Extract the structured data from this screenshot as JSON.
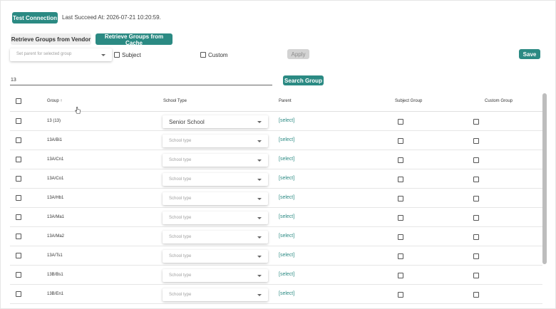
{
  "toolbar": {
    "test_connection": "Test Connection",
    "last_succeed": "Last Succeed At: 2026-07-21 10:20:59.",
    "retrieve_vendor": "Retrieve Groups from Vendor",
    "retrieve_cache": "Retrieve Groups from Cache",
    "parent_placeholder": "Set parent for selected group",
    "subject_label": "Subject",
    "custom_label": "Custom",
    "apply_label": "Apply",
    "save_label": "Save",
    "search_value": "13",
    "search_button": "Search Group"
  },
  "table": {
    "columns": {
      "group": "Group ↑",
      "school_type": "School Type",
      "parent": "Parent",
      "subject_group": "Subject Group",
      "custom_group": "Custom Group"
    },
    "rows": [
      {
        "group": "13 (13)",
        "school_type": "Senior School",
        "parent": "[select]"
      },
      {
        "group": "13A/Bi1",
        "school_type": "",
        "parent": "[select]"
      },
      {
        "group": "13A/Cn1",
        "school_type": "",
        "parent": "[select]"
      },
      {
        "group": "13A/Co1",
        "school_type": "",
        "parent": "[select]"
      },
      {
        "group": "13A/Hb1",
        "school_type": "",
        "parent": "[select]"
      },
      {
        "group": "13A/Ma1",
        "school_type": "",
        "parent": "[select]"
      },
      {
        "group": "13A/Ma2",
        "school_type": "",
        "parent": "[select]"
      },
      {
        "group": "13A/Ts1",
        "school_type": "",
        "parent": "[select]"
      },
      {
        "group": "13B/Bs1",
        "school_type": "",
        "parent": "[select]"
      },
      {
        "group": "13B/En1",
        "school_type": "",
        "parent": "[select]"
      }
    ],
    "school_type_placeholder": "School type"
  },
  "colors": {
    "accent": "#2b8a83",
    "disabled": "#d3d3d3"
  }
}
